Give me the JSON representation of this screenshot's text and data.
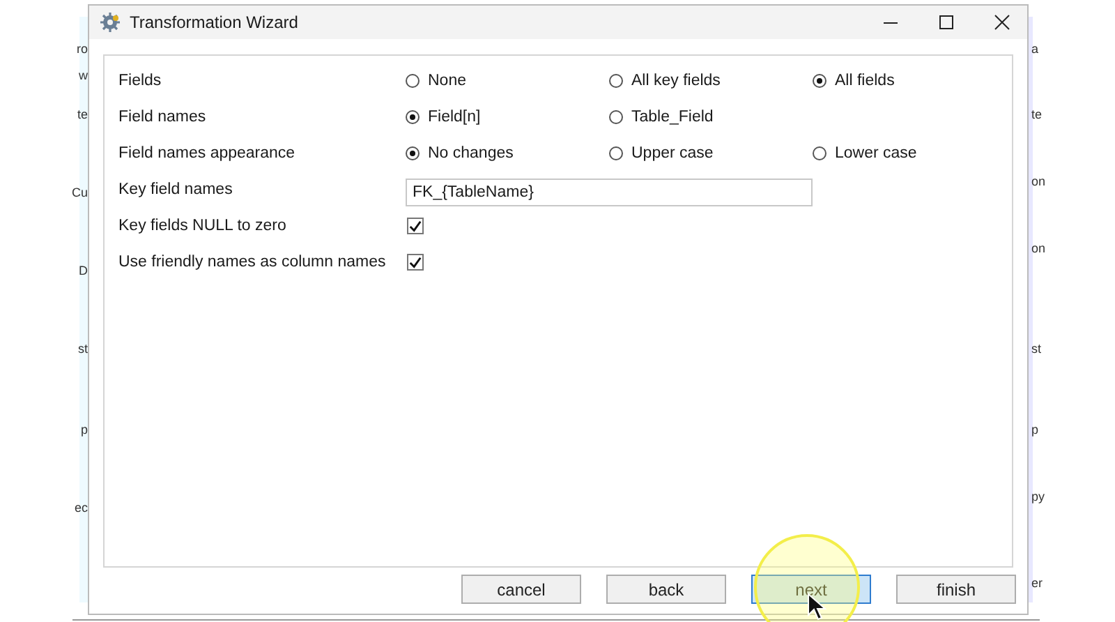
{
  "background_window": {
    "left_fragments": [
      "ro",
      "w",
      "te",
      "Cu",
      "D",
      "st",
      "p",
      "ec"
    ],
    "right_fragments": [
      "a",
      "te",
      "on",
      "on",
      "st",
      "p",
      "py",
      "er"
    ]
  },
  "window": {
    "title": "Transformation Wizard"
  },
  "settings": [
    {
      "label": "Fields",
      "kind": "radio",
      "options": [
        {
          "label": "None",
          "selected": false
        },
        {
          "label": "All key fields",
          "selected": false
        },
        {
          "label": "All fields",
          "selected": true
        }
      ]
    },
    {
      "label": "Field names",
      "kind": "radio",
      "options": [
        {
          "label": "Field[n]",
          "selected": true
        },
        {
          "label": "Table_Field",
          "selected": false
        }
      ]
    },
    {
      "label": "Field names appearance",
      "kind": "radio",
      "options": [
        {
          "label": "No changes",
          "selected": true
        },
        {
          "label": "Upper case",
          "selected": false
        },
        {
          "label": "Lower case",
          "selected": false
        }
      ]
    },
    {
      "label": "Key field names",
      "kind": "text",
      "value": "FK_{TableName}"
    },
    {
      "label": "Key fields NULL to zero",
      "kind": "checkbox",
      "checked": true
    },
    {
      "label": "Use friendly names as column names",
      "kind": "checkbox",
      "checked": true
    }
  ],
  "buttons": [
    {
      "label": "cancel",
      "focused": false
    },
    {
      "label": "back",
      "focused": false
    },
    {
      "label": "next",
      "focused": true
    },
    {
      "label": "finish",
      "focused": false
    }
  ]
}
